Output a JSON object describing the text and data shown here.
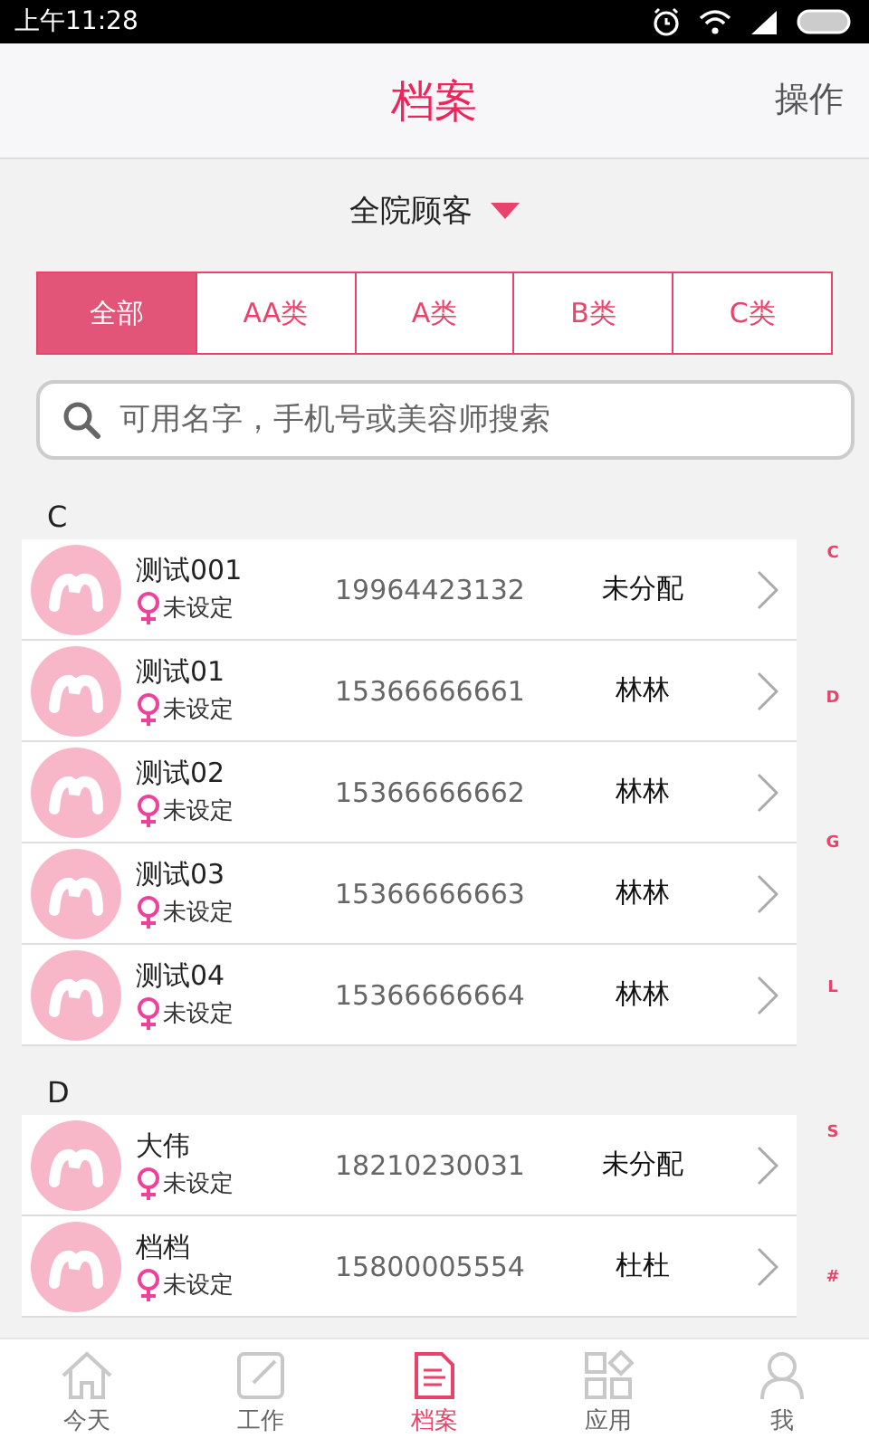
{
  "status_bar": {
    "time": "上午11:28"
  },
  "header": {
    "title": "档案",
    "action": "操作"
  },
  "filter": {
    "label": "全院顾客"
  },
  "segments": [
    {
      "label": "全部",
      "selected": true
    },
    {
      "label": "AA类",
      "selected": false
    },
    {
      "label": "A类",
      "selected": false
    },
    {
      "label": "B类",
      "selected": false
    },
    {
      "label": "C类",
      "selected": false
    }
  ],
  "search": {
    "placeholder": "可用名字，手机号或美容师搜索"
  },
  "sections": [
    {
      "letter": "C",
      "rows": [
        {
          "name": "测试001",
          "gender": "未设定",
          "phone": "19964423132",
          "staff": "未分配"
        },
        {
          "name": "测试01",
          "gender": "未设定",
          "phone": "15366666661",
          "staff": "林林"
        },
        {
          "name": "测试02",
          "gender": "未设定",
          "phone": "15366666662",
          "staff": "林林"
        },
        {
          "name": "测试03",
          "gender": "未设定",
          "phone": "15366666663",
          "staff": "林林"
        },
        {
          "name": "测试04",
          "gender": "未设定",
          "phone": "15366666664",
          "staff": "林林"
        }
      ]
    },
    {
      "letter": "D",
      "rows": [
        {
          "name": "大伟",
          "gender": "未设定",
          "phone": "18210230031",
          "staff": "未分配"
        },
        {
          "name": "档档",
          "gender": "未设定",
          "phone": "15800005554",
          "staff": "杜杜"
        }
      ]
    }
  ],
  "index_letters": [
    "C",
    "D",
    "G",
    "L",
    "S",
    "#"
  ],
  "tabs": [
    {
      "label": "今天",
      "kind": "home",
      "selected": false
    },
    {
      "label": "工作",
      "kind": "work",
      "selected": false
    },
    {
      "label": "档案",
      "kind": "file",
      "selected": true
    },
    {
      "label": "应用",
      "kind": "apps",
      "selected": false
    },
    {
      "label": "我",
      "kind": "me",
      "selected": false
    }
  ]
}
